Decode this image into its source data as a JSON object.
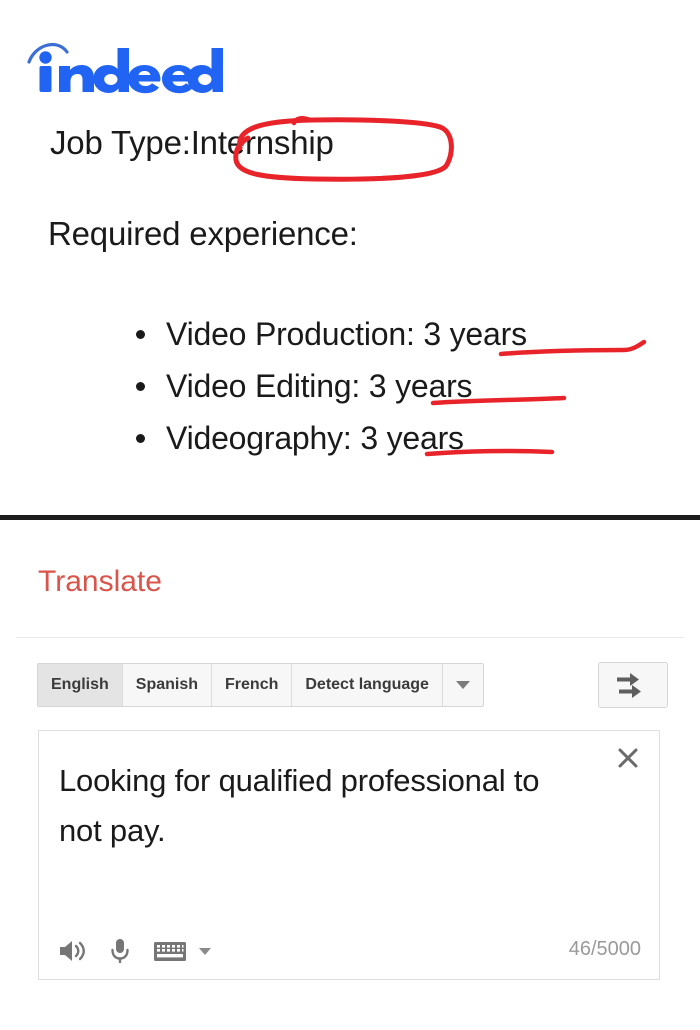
{
  "job_posting": {
    "logo_text": "indeed",
    "logo_color": "#2164f3",
    "job_type_label": "Job Type:",
    "job_type_value": "Internship",
    "required_heading": "Required experience:",
    "requirements": [
      {
        "skill": "Video Production:",
        "years": "3 years"
      },
      {
        "skill": "Video Editing:",
        "years": "3 years"
      },
      {
        "skill": "Videography:",
        "years": "3 years"
      }
    ],
    "annotation_color": "#e8232a"
  },
  "translate": {
    "title": "Translate",
    "title_color": "#d9544a",
    "languages": [
      {
        "label": "English",
        "selected": true
      },
      {
        "label": "Spanish",
        "selected": false
      },
      {
        "label": "French",
        "selected": false
      },
      {
        "label": "Detect language",
        "selected": false
      }
    ],
    "more_languages_icon": "chevron-down-icon",
    "swap_icon": "swap-languages-icon",
    "source_text": "Looking for qualified professional to not pay.",
    "clear_icon": "close-icon",
    "tools": [
      {
        "icon": "speaker-icon",
        "name": "listen-button"
      },
      {
        "icon": "microphone-icon",
        "name": "voice-input-button"
      },
      {
        "icon": "keyboard-icon",
        "name": "keyboard-button"
      }
    ],
    "char_count": "46/5000"
  }
}
